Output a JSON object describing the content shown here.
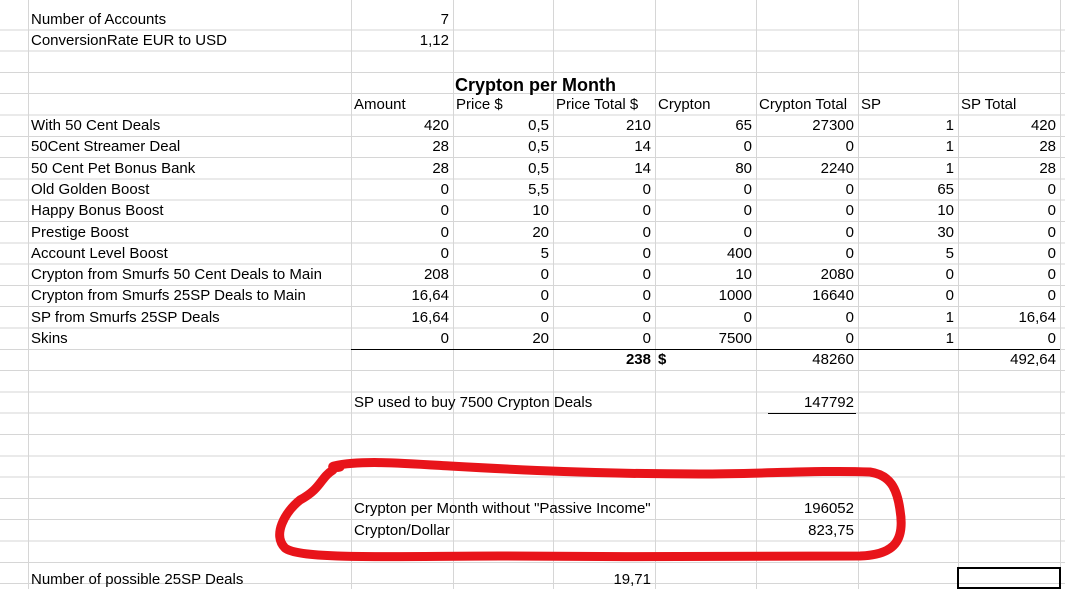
{
  "header_rows": [
    {
      "label": "Number of Accounts",
      "value": "7"
    },
    {
      "label": "ConversionRate EUR to USD",
      "value": "1,12"
    }
  ],
  "table_title": "Crypton per Month",
  "columns": [
    "Amount",
    "Price $",
    "Price Total $",
    "Crypton",
    "Crypton Total",
    "SP",
    "SP Total"
  ],
  "rows": [
    {
      "label": "With 50 Cent Deals",
      "values": [
        "420",
        "0,5",
        "210",
        "65",
        "27300",
        "1",
        "420"
      ]
    },
    {
      "label": "50Cent Streamer Deal",
      "values": [
        "28",
        "0,5",
        "14",
        "0",
        "0",
        "1",
        "28"
      ]
    },
    {
      "label": "50 Cent Pet Bonus Bank",
      "values": [
        "28",
        "0,5",
        "14",
        "80",
        "2240",
        "1",
        "28"
      ]
    },
    {
      "label": "Old Golden Boost",
      "values": [
        "0",
        "5,5",
        "0",
        "0",
        "0",
        "65",
        "0"
      ]
    },
    {
      "label": "Happy Bonus Boost",
      "values": [
        "0",
        "10",
        "0",
        "0",
        "0",
        "10",
        "0"
      ]
    },
    {
      "label": "Prestige Boost",
      "values": [
        "0",
        "20",
        "0",
        "0",
        "0",
        "30",
        "0"
      ]
    },
    {
      "label": "Account Level Boost",
      "values": [
        "0",
        "5",
        "0",
        "400",
        "0",
        "5",
        "0"
      ]
    },
    {
      "label": "Crypton from Smurfs 50 Cent Deals to Main",
      "values": [
        "208",
        "0",
        "0",
        "10",
        "2080",
        "0",
        "0"
      ]
    },
    {
      "label": "Crypton from Smurfs 25SP Deals to Main",
      "values": [
        "16,64",
        "0",
        "0",
        "1000",
        "16640",
        "0",
        "0"
      ]
    },
    {
      "label": "SP from Smurfs 25SP Deals",
      "values": [
        "16,64",
        "0",
        "0",
        "0",
        "0",
        "1",
        "16,64"
      ]
    },
    {
      "label": "Skins",
      "values": [
        "0",
        "20",
        "0",
        "7500",
        "0",
        "1",
        "0"
      ]
    }
  ],
  "totals": {
    "price_total": "238",
    "currency": "$",
    "crypton_total": "48260",
    "sp_total": "492,64"
  },
  "sp_used": {
    "label": "SP used to buy 7500 Crypton Deals",
    "value": "147792"
  },
  "summary": [
    {
      "label": "Crypton per Month without \"Passive Income\"",
      "value": "196052"
    },
    {
      "label": "Crypton/Dollar",
      "value": "823,75"
    }
  ],
  "possible_deals": {
    "label": "Number of possible 25SP Deals",
    "value": "19,71"
  },
  "annotation_color": "#e8141a"
}
